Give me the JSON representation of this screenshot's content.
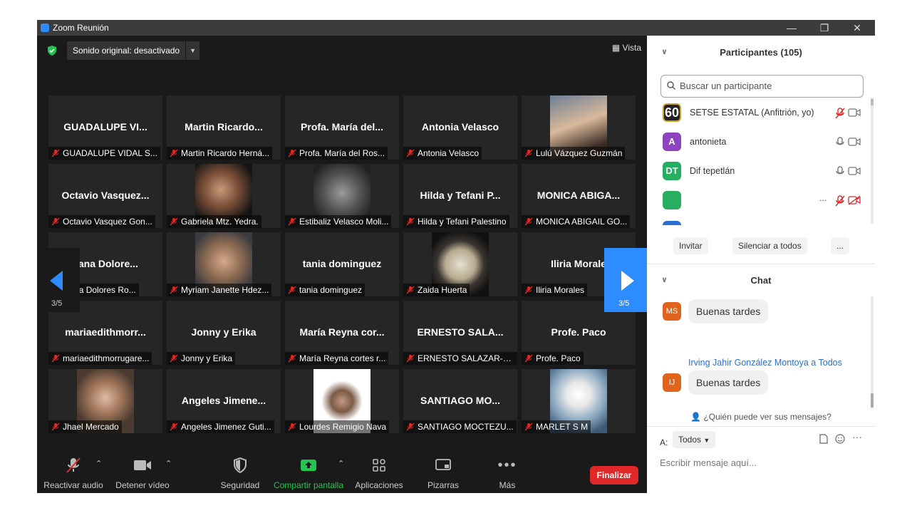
{
  "window": {
    "title": "Zoom Reunión",
    "controls": [
      "—",
      "❐",
      "✕"
    ]
  },
  "topbar": {
    "audio_chip": "Sonido original: desactivado",
    "view_label": "Vista"
  },
  "tiles": [
    {
      "big": "GUADALUPE VI...",
      "label": "GUADALUPE VIDAL S..."
    },
    {
      "big": "Martin Ricardo...",
      "label": "Martin Ricardo Herná..."
    },
    {
      "big": "Profa. María del...",
      "label": "Profa. María del Ros..."
    },
    {
      "big": "Antonia Velasco",
      "label": "Antonia Velasco"
    },
    {
      "big": "",
      "label": "Lulú Vázquez Guzmán",
      "photo": "woman-smiling"
    },
    {
      "big": "Octavio Vasquez...",
      "label": "Octavio Vasquez Gon..."
    },
    {
      "big": "",
      "label": "Gabriela Mtz. Yedra.",
      "photo": "man-portrait"
    },
    {
      "big": "",
      "label": "Estibaliz Velasco Moli...",
      "photo": "woman-bw"
    },
    {
      "big": "Hilda y Tefani P...",
      "label": "Hilda y Tefani Palestino"
    },
    {
      "big": "MONICA ABIGA...",
      "label": "MONICA ABIGAIL GO..."
    },
    {
      "big": "liana Dolore...",
      "label": "diana Dolores Ro..."
    },
    {
      "big": "",
      "label": "Myriam Janette Hdez...",
      "photo": "woman-car"
    },
    {
      "big": "tania dominguez",
      "label": "tania dominguez"
    },
    {
      "big": "",
      "label": "Zaida Huerta",
      "photo": "woman-vignette"
    },
    {
      "big": "Iliria Morale",
      "label": "Iliria Morales"
    },
    {
      "big": "mariaedithmorr...",
      "label": "mariaedithmorrugare..."
    },
    {
      "big": "Jonny y Erika",
      "label": "Jonny y Erika"
    },
    {
      "big": "María Reyna cor...",
      "label": "María Reyna cortes r..."
    },
    {
      "big": "ERNESTO SALA...",
      "label": "ERNESTO SALAZAR-H..."
    },
    {
      "big": "Profe. Paco",
      "label": "Profe. Paco"
    },
    {
      "big": "",
      "label": "Jhael Mercado",
      "photo": "woman-selfie"
    },
    {
      "big": "Angeles Jimene...",
      "label": "Angeles Jimenez Guti..."
    },
    {
      "big": "",
      "label": "Lourdes Remigio Nava",
      "photo": "woman-white-bg"
    },
    {
      "big": "SANTIAGO MO...",
      "label": "SANTIAGO MOCTEZU..."
    },
    {
      "big": "",
      "label": "MARLET S M",
      "photo": "eagle"
    }
  ],
  "pager": {
    "left": "3/5",
    "right": "3/5"
  },
  "toolbar": {
    "audio": "Reactivar audio",
    "video": "Detener vídeo",
    "security": "Seguridad",
    "share": "Compartir pantalla",
    "apps": "Aplicaciones",
    "whiteboards": "Pizarras",
    "more": "Más",
    "end": "Finalizar"
  },
  "participants": {
    "header": "Participantes (105)",
    "search_placeholder": "Buscar un participante",
    "rows": [
      {
        "avatar": "60",
        "name": "SETSE ESTATAL (Anfitrión, yo)",
        "color": "#222222"
      },
      {
        "avatar": "A",
        "name": "antonieta",
        "color": "#8e44c0"
      },
      {
        "avatar": "DT",
        "name": "Dif tepetlán",
        "color": "#27ae60"
      },
      {
        "avatar": "",
        "name": "",
        "color": "#27ae60",
        "dots": "..."
      }
    ],
    "actions": [
      "Invitar",
      "Silenciar a todos",
      "..."
    ]
  },
  "chat": {
    "header": "Chat",
    "messages": [
      {
        "avatar": "MS",
        "text": "Buenas tardes"
      },
      {
        "avatar": "IJ",
        "text": "Buenas tardes"
      }
    ],
    "sender_line": "Irving Jahir González Montoya a Todos",
    "who_can_see": "¿Quién puede ver sus mensajes?",
    "to_label": "A:",
    "to_value": "Todos",
    "input_placeholder": "Escribir mensaje aquí..."
  }
}
